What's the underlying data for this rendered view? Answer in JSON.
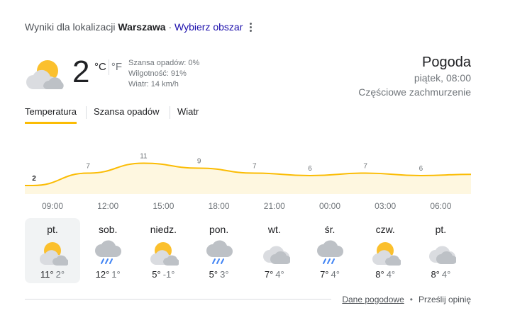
{
  "location": {
    "prefix": "Wyniki dla lokalizacji",
    "name": "Warszawa",
    "separator": "·",
    "choose_area": "Wybierz obszar"
  },
  "current": {
    "icon": "partly-cloudy-icon",
    "temperature": "2",
    "unit_c": "°C",
    "unit_f": "°F",
    "precipitation": "Szansa opadów: 0%",
    "humidity": "Wilgotność: 91%",
    "wind": "Wiatr: 14 km/h"
  },
  "header": {
    "title": "Pogoda",
    "datetime": "piątek, 08:00",
    "condition": "Częściowe zachmurzenie"
  },
  "tabs": [
    {
      "label": "Temperatura",
      "active": true
    },
    {
      "label": "Szansa opadów",
      "active": false
    },
    {
      "label": "Wiatr",
      "active": false
    }
  ],
  "chart_data": {
    "type": "area",
    "points": [
      2,
      7,
      11,
      9,
      7,
      6,
      7,
      6
    ],
    "labels": [
      "2",
      "7",
      "11",
      "9",
      "7",
      "6",
      "7",
      "6"
    ],
    "x": [
      "09:00",
      "12:00",
      "15:00",
      "18:00",
      "21:00",
      "00:00",
      "03:00",
      "06:00"
    ],
    "color": "#fbbc04",
    "fill": "#fef7e0"
  },
  "forecast": [
    {
      "day": "pt.",
      "icon": "partly-cloudy-icon",
      "high": "11°",
      "low": "2°",
      "selected": true
    },
    {
      "day": "sob.",
      "icon": "rain-icon",
      "high": "12°",
      "low": "1°",
      "selected": false
    },
    {
      "day": "niedz.",
      "icon": "partly-cloudy-icon",
      "high": "5°",
      "low": "-1°",
      "selected": false
    },
    {
      "day": "pon.",
      "icon": "rain-icon",
      "high": "5°",
      "low": "3°",
      "selected": false
    },
    {
      "day": "wt.",
      "icon": "cloudy-icon",
      "high": "7°",
      "low": "4°",
      "selected": false
    },
    {
      "day": "śr.",
      "icon": "rain-icon",
      "high": "7°",
      "low": "4°",
      "selected": false
    },
    {
      "day": "czw.",
      "icon": "partly-cloudy-icon",
      "high": "8°",
      "low": "4°",
      "selected": false
    },
    {
      "day": "pt.",
      "icon": "cloudy-icon",
      "high": "8°",
      "low": "4°",
      "selected": false
    }
  ],
  "footer": {
    "data_link": "Dane pogodowe",
    "separator": "•",
    "feedback": "Prześlij opinię"
  }
}
